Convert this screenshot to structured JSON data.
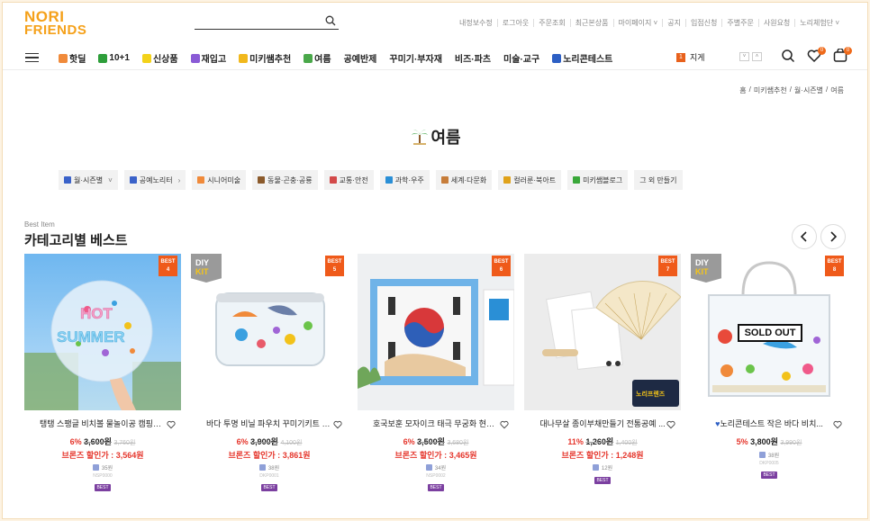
{
  "header": {
    "logo_line1": "NORI",
    "logo_line2": "FRIENDS",
    "search_placeholder": "",
    "util_links": [
      "내정보수정",
      "로그아웃",
      "주문조회",
      "최근본상품",
      "마이페이지 ˅",
      "공지",
      "입점신청",
      "주별주문",
      "사원요청",
      "노리체험단 ˅"
    ]
  },
  "nav": {
    "items": [
      {
        "label": "핫딜",
        "color": "#f08a3a"
      },
      {
        "label": "10+1",
        "color": "#2e9e3a"
      },
      {
        "label": "신상품",
        "color": "#f3d21a"
      },
      {
        "label": "재입고",
        "color": "#8a5bd6"
      },
      {
        "label": "미키쌤추천",
        "color": "#f1b81c"
      },
      {
        "label": "여름",
        "color": "#4aa84a"
      },
      {
        "label": "공예반제",
        "color": ""
      },
      {
        "label": "꾸미기·부자재",
        "color": ""
      },
      {
        "label": "비즈·파츠",
        "color": ""
      },
      {
        "label": "미술·교구",
        "color": ""
      },
      {
        "label": "노리콘테스트",
        "color": "#2d5fc4"
      }
    ],
    "watch_num": "1",
    "watch_label": "지게",
    "wish_count": "0",
    "cart_count": "0"
  },
  "breadcrumb": [
    "홈",
    "/",
    "미키쌤추천",
    "/",
    "월·시즌별",
    "/",
    "여름"
  ],
  "page_title": "여름",
  "chips": [
    {
      "label": "월·시즌별",
      "color": "#3a62c9",
      "arrow": "˅"
    },
    {
      "label": "공예노리터",
      "color": "#3a62c9",
      "arrow": "›"
    },
    {
      "label": "시니어미술",
      "color": "#f08a3a",
      "arrow": ""
    },
    {
      "label": "동물·곤충·공룡",
      "color": "#8b5a2b",
      "arrow": ""
    },
    {
      "label": "교통·안전",
      "color": "#d34a4a",
      "arrow": ""
    },
    {
      "label": "과학·우주",
      "color": "#2a8fd6",
      "arrow": ""
    },
    {
      "label": "세계·다문화",
      "color": "#c77d3a",
      "arrow": ""
    },
    {
      "label": "컬러룬·북아트",
      "color": "#e0a21a",
      "arrow": ""
    },
    {
      "label": "미키쌤블로그",
      "color": "#3aa83a",
      "arrow": ""
    },
    {
      "label": "그 외 만들기",
      "color": "",
      "arrow": ""
    }
  ],
  "section": {
    "sub": "Best Item",
    "title": "카테고리별 베스트"
  },
  "products": [
    {
      "best": "BEST",
      "rank": "4",
      "diy": false,
      "name": "탱탱 스팽글 비치볼 물놀이공 캠핑놀...",
      "rate": "6%",
      "cur": "3,600원",
      "orig": "3,760원",
      "sale_label": "브론즈 할인가 :",
      "sale_price": "3,564원",
      "point": "35원",
      "code": "NSP0000",
      "badge": "BEST"
    },
    {
      "best": "BEST",
      "rank": "5",
      "diy": true,
      "name": "바다 투명 비닐 파우치 꾸미기키트 DI...",
      "rate": "6%",
      "cur": "3,900원",
      "orig": "4,100원",
      "sale_label": "브론즈 할인가 :",
      "sale_price": "3,861원",
      "point": "38원",
      "code": "DKP0001",
      "badge": "BEST"
    },
    {
      "best": "BEST",
      "rank": "6",
      "diy": false,
      "name": "호국보훈 모자이크 태극 무궁화 현충...",
      "rate": "6%",
      "cur": "3,500원",
      "orig": "3,680원",
      "sale_label": "브론즈 할인가 :",
      "sale_price": "3,465원",
      "point": "34원",
      "code": "NSP0002",
      "badge": "BEST"
    },
    {
      "best": "BEST",
      "rank": "7",
      "diy": false,
      "name": "대나무살 종이부채만들기 전통공예 ...",
      "rate": "11%",
      "cur": "1,260원",
      "orig": "1,400원",
      "sale_label": "브론즈 할인가 :",
      "sale_price": "1,248원",
      "point": "12원",
      "code": "",
      "badge": "BEST"
    },
    {
      "best": "BEST",
      "rank": "8",
      "diy": true,
      "name": "노리콘테스트 작은 바다 비치...",
      "rate": "5%",
      "cur": "3,800원",
      "orig": "3,990원",
      "sale_label": "",
      "sale_price": "",
      "point": "38원",
      "code": "DKP0005",
      "badge": "BEST",
      "sold_out": "SOLD OUT"
    }
  ]
}
